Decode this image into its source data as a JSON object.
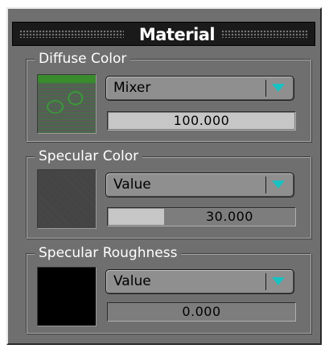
{
  "panel": {
    "title": "Material"
  },
  "sections": [
    {
      "label": "Diffuse Color",
      "swatch": "mixer-texture-preview",
      "dropdown": {
        "selected": "Mixer"
      },
      "value": {
        "text": "100.000",
        "fill_fraction": 1.0
      }
    },
    {
      "label": "Specular Color",
      "swatch": "dark-gray",
      "dropdown": {
        "selected": "Value"
      },
      "value": {
        "text": "30.000",
        "fill_fraction": 0.3
      }
    },
    {
      "label": "Specular Roughness",
      "swatch": "black",
      "dropdown": {
        "selected": "Value"
      },
      "value": {
        "text": "0.000",
        "fill_fraction": 0.0
      }
    }
  ],
  "colors": {
    "panel_bg": "#6f6f6f",
    "titlebar_bg": "#1a1a1a",
    "dropdown_arrow": "#19c2c2",
    "value_fill": "#c6c6c6"
  },
  "icons": {
    "dropdown": "triangle-down-icon"
  }
}
